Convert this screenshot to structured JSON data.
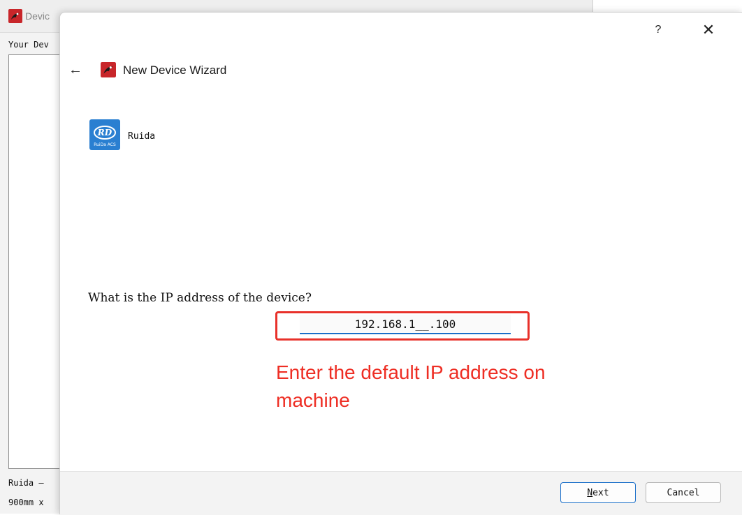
{
  "background_window": {
    "title": "Devic",
    "list_label": "Your Dev",
    "status_line1": "Ruida –",
    "status_line2": "900mm x"
  },
  "dialog": {
    "help_label": "?",
    "close_label": "✕",
    "back_label": "←",
    "title": "New Device Wizard",
    "vendor": {
      "name": "Ruida",
      "logo_text": "RD",
      "logo_subtext": "RuiDa ACS"
    },
    "question": "What is the IP address of the device?",
    "ip_address": "192.168.1__.100",
    "annotation_line1": "Enter the default IP address on",
    "annotation_line2": "machine",
    "buttons": {
      "next_mnemonic": "N",
      "next_rest": "ext",
      "cancel": "Cancel"
    }
  },
  "colors": {
    "highlight": "#e8312a",
    "annotation": "#ee2e24",
    "accent": "#1a6fc9",
    "logo": "#2a7fd1"
  },
  "icons": [
    "app-icon",
    "back-arrow-icon",
    "help-icon",
    "close-icon",
    "ruida-logo-icon"
  ]
}
